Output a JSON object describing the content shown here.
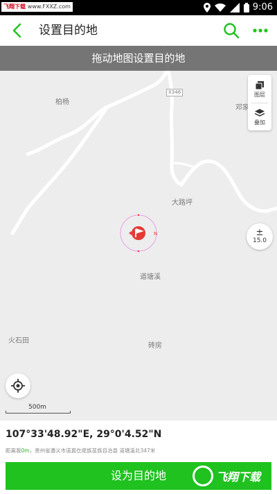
{
  "status_bar": {
    "watermark_brand": "飞翔下载",
    "watermark_url": "www.FXXZ.com",
    "time": "9:06"
  },
  "app_bar": {
    "title": "设置目的地",
    "back_icon": "chevron-left-icon",
    "search_icon": "search-icon",
    "more_icon": "more-dots-icon"
  },
  "map": {
    "hint": "拖动地图设置目的地",
    "places": {
      "baiyang": "柏杨",
      "deng": "邓家",
      "daluping": "大路坪",
      "daotangxi": "道塘溪",
      "huoshitian": "火石田",
      "zhuanfang": "砖房"
    },
    "road_tag": "X346",
    "layers": {
      "layers_label": "图层",
      "overlay_label": "叠加"
    },
    "zoom": {
      "symbol": "±",
      "level": "15.0"
    },
    "scale_label": "500m"
  },
  "info": {
    "coordinates": "107°33'48.92\"E, 29°0'4.52\"N",
    "distance_prefix": "距离我",
    "distance": "0m",
    "address": "，贵州省遵义市道真仡佬族苗族自治县 道塘溪北347米"
  },
  "action": {
    "set_destination_label": "设为目的地"
  },
  "watermark_logo_text": "飞翔下载",
  "colors": {
    "accent": "#1fc21f",
    "hint_bg": "#5f5f5f",
    "map_bg": "#ededed",
    "pin": "#e53935"
  }
}
